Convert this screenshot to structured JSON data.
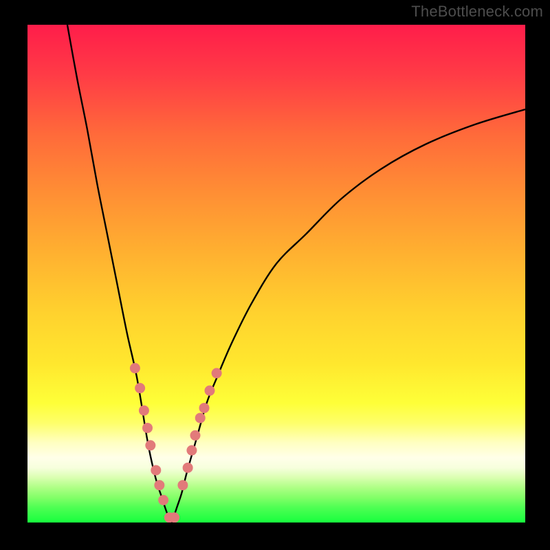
{
  "attribution": "TheBottleneck.com",
  "colors": {
    "background": "#000000",
    "gradient_top": "#ff1d4a",
    "gradient_mid": "#ffe72e",
    "gradient_bottom": "#17ff3e",
    "curve": "#000000",
    "marker": "#e27a7a"
  },
  "chart_data": {
    "type": "line",
    "title": "",
    "xlabel": "",
    "ylabel": "",
    "xlim": [
      0,
      100
    ],
    "ylim": [
      0,
      100
    ],
    "series": [
      {
        "name": "left-curve",
        "x": [
          8,
          10,
          12,
          14,
          16,
          18,
          20,
          22,
          24,
          25,
          26,
          27,
          28,
          29
        ],
        "y": [
          100,
          89,
          79,
          68,
          58,
          48,
          38,
          29,
          17,
          12,
          8,
          5,
          2,
          0
        ]
      },
      {
        "name": "right-curve",
        "x": [
          29,
          30,
          31,
          32,
          34,
          36,
          38,
          41,
          45,
          50,
          56,
          63,
          71,
          80,
          90,
          100
        ],
        "y": [
          0,
          3,
          6,
          10,
          17,
          24,
          29,
          36,
          44,
          52,
          58,
          65,
          71,
          76,
          80,
          83
        ]
      }
    ],
    "markers": {
      "name": "marker-cluster",
      "x": [
        21.6,
        22.6,
        23.4,
        24.1,
        24.7,
        25.8,
        26.5,
        27.3,
        28.5,
        29.5,
        31.2,
        32.2,
        33.0,
        33.7,
        34.7,
        35.5,
        36.6,
        38.0
      ],
      "y": [
        31.0,
        27.0,
        22.5,
        19.0,
        15.5,
        10.5,
        7.5,
        4.5,
        1.0,
        1.0,
        7.5,
        11.0,
        14.5,
        17.5,
        21.0,
        23.0,
        26.5,
        30.0
      ]
    }
  }
}
